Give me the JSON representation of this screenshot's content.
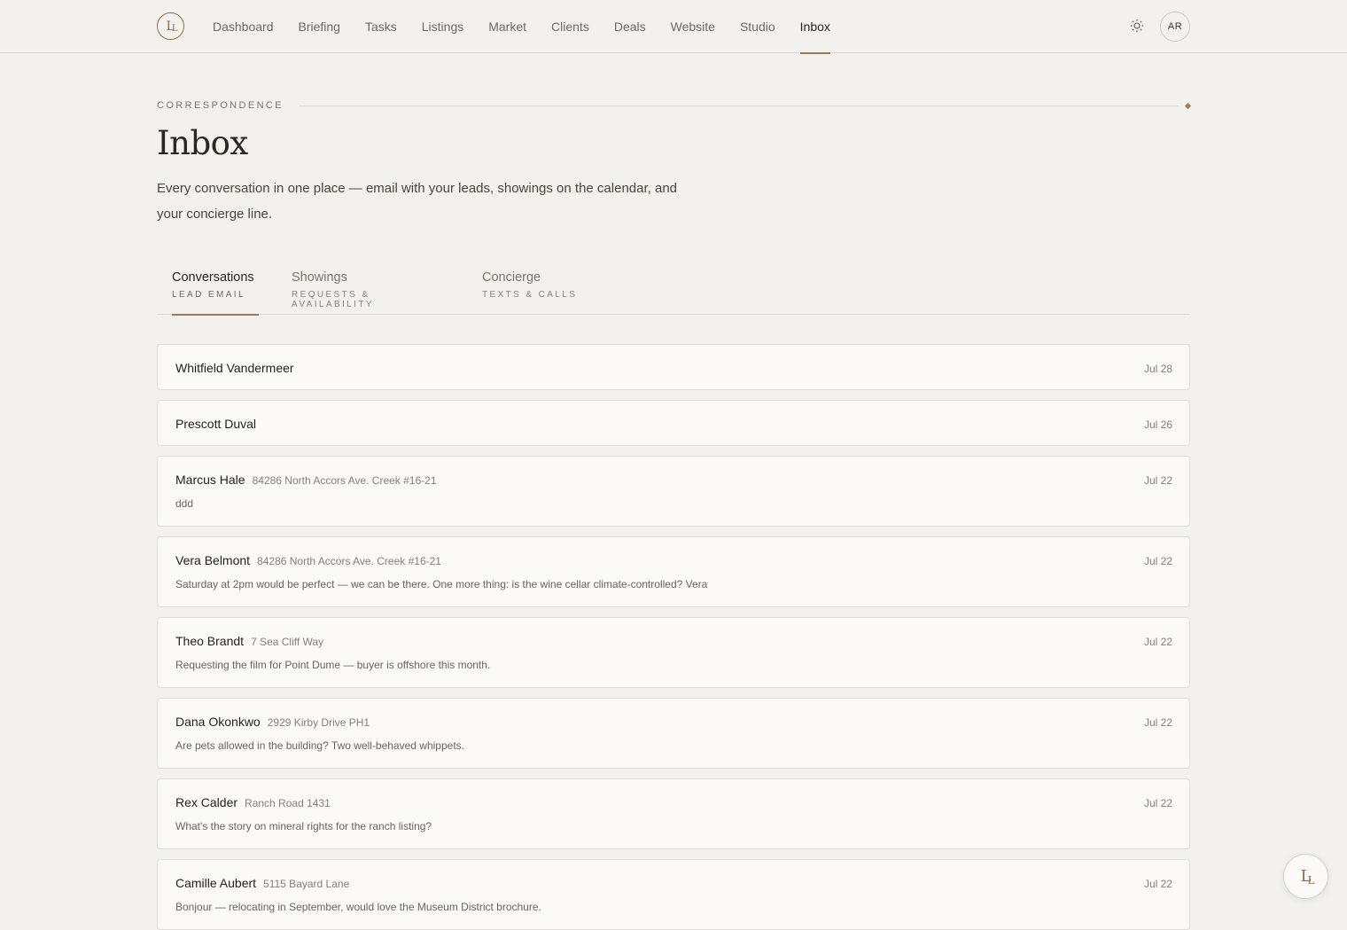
{
  "brand": {
    "logo_text": "L",
    "logo_text2": "L"
  },
  "nav": {
    "items": [
      {
        "label": "Dashboard"
      },
      {
        "label": "Briefing"
      },
      {
        "label": "Tasks"
      },
      {
        "label": "Listings"
      },
      {
        "label": "Market"
      },
      {
        "label": "Clients"
      },
      {
        "label": "Deals"
      },
      {
        "label": "Website"
      },
      {
        "label": "Studio"
      },
      {
        "label": "Inbox",
        "active": true
      }
    ],
    "theme_icon": "sun-icon",
    "avatar_initials": "AR"
  },
  "header": {
    "eyebrow": "CORRESPONDENCE",
    "title": "Inbox",
    "description": "Every conversation in one place — email with your leads, showings on the calendar, and your concierge line."
  },
  "tabs": [
    {
      "label": "Conversations",
      "sub": "LEAD EMAIL",
      "active": true
    },
    {
      "label": "Showings",
      "sub": "REQUESTS & AVAILABILITY",
      "active": false
    },
    {
      "label": "Concierge",
      "sub": "TEXTS & CALLS",
      "active": false
    }
  ],
  "conversations": [
    {
      "name": "Whitfield Vandermeer",
      "address": "",
      "date": "Jul 28",
      "preview": ""
    },
    {
      "name": "Prescott Duval",
      "address": "",
      "date": "Jul 26",
      "preview": ""
    },
    {
      "name": "Marcus Hale",
      "address": "84286 North Accors Ave. Creek #16-21",
      "date": "Jul 22",
      "preview": "ddd"
    },
    {
      "name": "Vera Belmont",
      "address": "84286 North Accors Ave. Creek #16-21",
      "date": "Jul 22",
      "preview": "Saturday at 2pm would be perfect — we can be there. One more thing: is the wine cellar climate-controlled? Vera"
    },
    {
      "name": "Theo Brandt",
      "address": "7 Sea Cliff Way",
      "date": "Jul 22",
      "preview": "Requesting the film for Point Dume — buyer is offshore this month."
    },
    {
      "name": "Dana Okonkwo",
      "address": "2929 Kirby Drive PH1",
      "date": "Jul 22",
      "preview": "Are pets allowed in the building? Two well-behaved whippets."
    },
    {
      "name": "Rex Calder",
      "address": "Ranch Road 1431",
      "date": "Jul 22",
      "preview": "What's the story on mineral rights for the ranch listing?"
    },
    {
      "name": "Camille Aubert",
      "address": "5115 Bayard Lane",
      "date": "Jul 22",
      "preview": "Bonjour — relocating in September, would love the Museum District brochure."
    }
  ],
  "fab": {
    "text": "L",
    "text2": "L"
  },
  "colors": {
    "accent": "#9b7b58",
    "background": "#f2f1ed",
    "card": "#fbfaf8"
  }
}
